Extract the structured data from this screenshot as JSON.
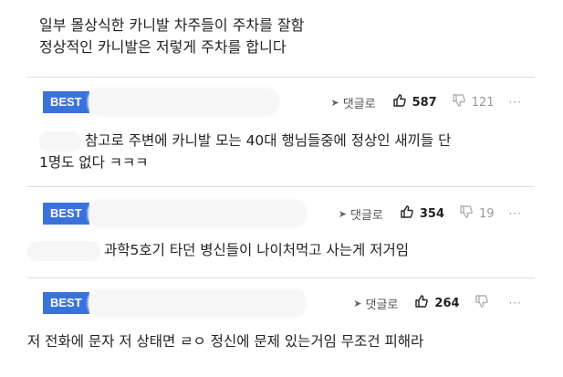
{
  "post": {
    "line1": "일부 몰상식한 카니발 차주들이 주차를 잘함",
    "line2": "정상적인 카니발은 저렇게 주차를 합니다"
  },
  "comments": [
    {
      "badge": "BEST",
      "reply_label": "댓글로",
      "likes": "587",
      "dislikes": "121",
      "more": "···",
      "text_line1": "참고로 주변에 카니발 모는 40대 행님들중에 정상인 새끼들 단",
      "text_line2": "1명도 없다 ㅋㅋㅋ"
    },
    {
      "badge": "BEST",
      "reply_label": "댓글로",
      "likes": "354",
      "dislikes": "19",
      "more": "···",
      "text_line1": "과학5호기 타던 병신들이 나이처먹고 사는게 저거임"
    },
    {
      "badge": "BEST",
      "reply_label": "댓글로",
      "likes": "264",
      "dislikes": "",
      "more": "···",
      "text_line1": "저 전화에 문자 저 상태면 ㄹㅇ 정신에 문제 있는거임 무조건 피해라"
    }
  ],
  "colors": {
    "badge": "#3a72dc",
    "divider": "#dcdcdc",
    "muted": "#999999"
  },
  "icons": {
    "reply": "send-arrow-icon",
    "like": "thumbs-up-icon",
    "dislike": "thumbs-down-icon",
    "more": "more-dots-icon"
  }
}
